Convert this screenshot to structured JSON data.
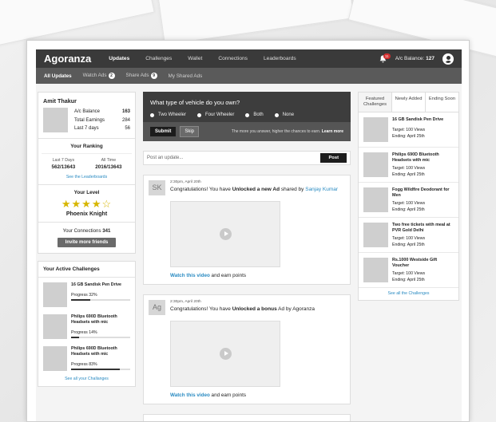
{
  "app": {
    "logo": "Agoranza"
  },
  "nav": {
    "links": [
      "Updates",
      "Challenges",
      "Wallet",
      "Connections",
      "Leaderboards"
    ],
    "notifications": "11",
    "balance_label": "A/c Balance:",
    "balance_value": "127"
  },
  "subnav": {
    "tabs": [
      {
        "label": "All Updates",
        "count": ""
      },
      {
        "label": "Watch Ads",
        "count": "2"
      },
      {
        "label": "Share Ads",
        "count": "9"
      },
      {
        "label": "My Shared Ads",
        "count": ""
      }
    ]
  },
  "profile": {
    "name": "Amit Thakur",
    "stats": [
      {
        "label": "A/c Balance",
        "value": "163"
      },
      {
        "label": "Total Earnings",
        "value": "284"
      },
      {
        "label": "Last 7 days",
        "value": "56"
      }
    ]
  },
  "ranking": {
    "title": "Your Ranking",
    "last7_label": "Last 7 Days",
    "last7_value": "562/13643",
    "all_label": "All Time",
    "all_value": "2016/13643",
    "link": "See the Leaderboards"
  },
  "level": {
    "title": "Your Level",
    "stars": "★★★★☆",
    "rating": 4,
    "name": "Phoenix Knight"
  },
  "connections": {
    "label": "Your Connections",
    "count": "341",
    "button": "Invite more friends"
  },
  "active_challenges": {
    "title": "Your Active Challenges",
    "items": [
      {
        "title": "16 GB Sandisk Pen Drive",
        "progress": "Progress 32%",
        "pct": 32
      },
      {
        "title": "Philips 690D Bluetooth Headsets with mic",
        "progress": "Progress 14%",
        "pct": 14
      },
      {
        "title": "Philips 690D Bluetooth Headsets with mic",
        "progress": "Progress 83%",
        "pct": 83
      }
    ],
    "link": "See all your Challanges"
  },
  "question": {
    "title": "What type of vehicle do you own?",
    "options": [
      "Two Wheeler",
      "Four Wheeler",
      "Both",
      "None"
    ],
    "submit": "Submit",
    "skip": "Skip",
    "note": "The more you answer, higher the chances to earn.",
    "learn_more": "Learn more"
  },
  "post": {
    "placeholder": "Post an update...",
    "button": "Post"
  },
  "feed": [
    {
      "initials": "SK",
      "time": "2:30pm, April 20th",
      "msg_pre": "Congratulations! You have ",
      "msg_bold": "Unlocked a new Ad",
      "msg_mid": " shared by ",
      "msg_link": "Sanjay Kumar",
      "watch_link": "Watch this video",
      "watch_rest": " and earn points"
    },
    {
      "initials": "Ag",
      "time": "2:30pm, April 20th",
      "msg_pre": "Congratulations! You have ",
      "msg_bold": "Unlocked a bonus",
      "msg_mid": " Ad by Agoranza",
      "msg_link": "",
      "watch_link": "Watch this video",
      "watch_rest": " and earn points"
    }
  ],
  "featured": {
    "tabs": [
      "Featured Challenges",
      "Newly Added",
      "Ending Soon"
    ],
    "items": [
      {
        "title": "16 GB Sandisk Pen Drive",
        "target": "Target: 100 Views",
        "ending": "Ending: April 25th"
      },
      {
        "title": "Philips 690D Bluetooth Headsets with mic",
        "target": "Target: 100 Views",
        "ending": "Ending: April 25th"
      },
      {
        "title": "Fogg Wildfire Deodorant for Men",
        "target": "Target: 100 Views",
        "ending": "Ending: April 25th"
      },
      {
        "title": "Two free tickets with meal at PVR Gold Delhi",
        "target": "Target: 100 Views",
        "ending": "Ending: April 25th"
      },
      {
        "title": "Rs.1000 Westside Gift Voucher",
        "target": "Target: 100 Views",
        "ending": "Ending: April 25th"
      }
    ],
    "link": "See all the Challenges"
  }
}
